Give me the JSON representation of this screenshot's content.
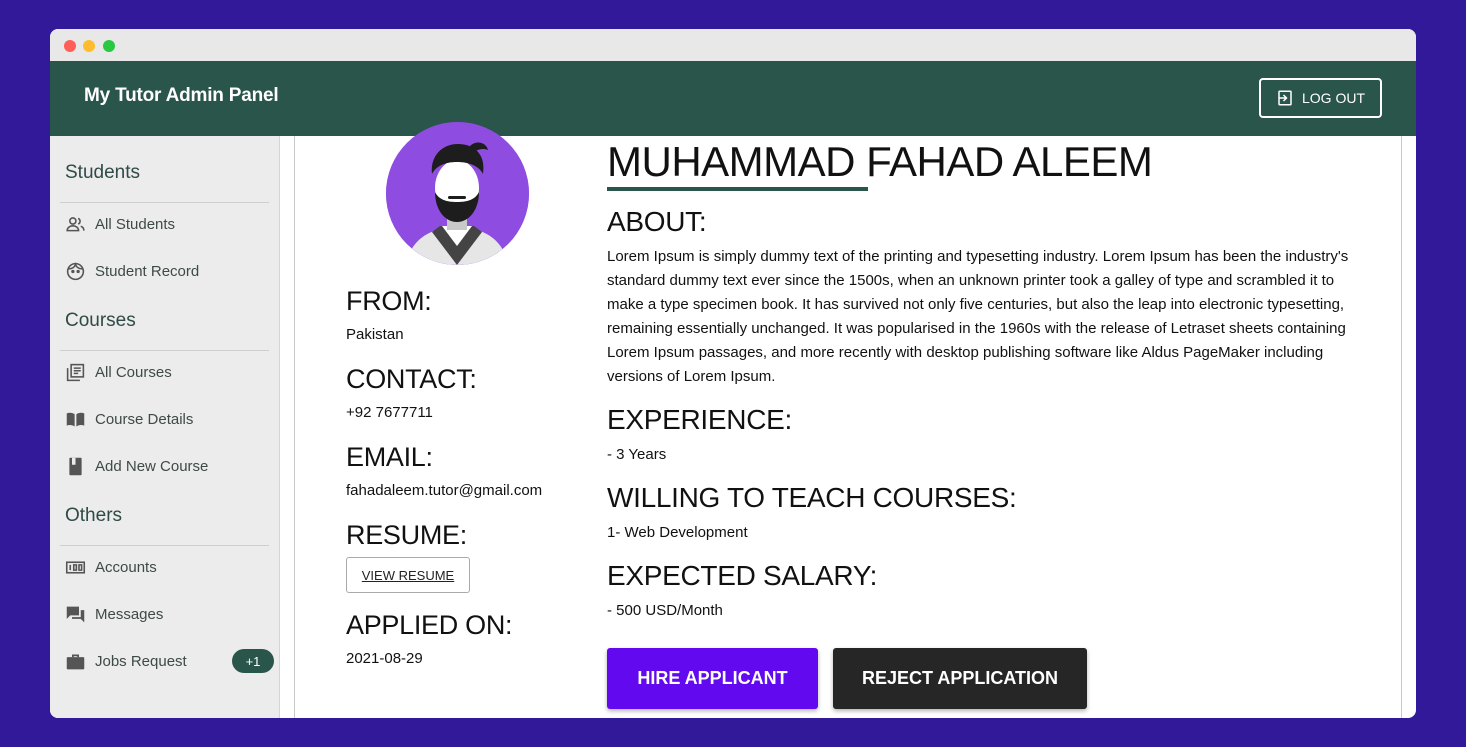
{
  "appbar": {
    "title": "My Tutor Admin Panel",
    "logout_label": "LOG OUT"
  },
  "sidebar": {
    "sections": [
      {
        "title": "Students",
        "items": [
          {
            "label": "All Students",
            "icon": "people-icon"
          },
          {
            "label": "Student Record",
            "icon": "face-icon"
          }
        ]
      },
      {
        "title": "Courses",
        "items": [
          {
            "label": "All Courses",
            "icon": "library-books-icon"
          },
          {
            "label": "Course Details",
            "icon": "open-book-icon"
          },
          {
            "label": "Add New Course",
            "icon": "book-icon"
          }
        ]
      },
      {
        "title": "Others",
        "items": [
          {
            "label": "Accounts",
            "icon": "counter-icon"
          },
          {
            "label": "Messages",
            "icon": "forum-icon"
          },
          {
            "label": "Jobs Request",
            "icon": "briefcase-icon",
            "badge": "+1"
          }
        ]
      }
    ]
  },
  "profile": {
    "name": "MUHAMMAD FAHAD ALEEM",
    "from_label": "FROM:",
    "from": "Pakistan",
    "contact_label": "CONTACT:",
    "contact": "+92 7677711",
    "email_label": "EMAIL:",
    "email": "fahadaleem.tutor@gmail.com",
    "resume_label": "RESUME:",
    "resume_button": "VIEW RESUME",
    "applied_label": "APPLIED ON:",
    "applied_on": "2021-08-29",
    "about_label": "ABOUT:",
    "about": "Lorem Ipsum is simply dummy text of the printing and typesetting industry. Lorem Ipsum has been the industry's standard dummy text ever since the 1500s, when an unknown printer took a galley of type and scrambled it to make a type specimen book. It has survived not only five centuries, but also the leap into electronic typesetting, remaining essentially unchanged. It was popularised in the 1960s with the release of Letraset sheets containing Lorem Ipsum passages, and more recently with desktop publishing software like Aldus PageMaker including versions of Lorem Ipsum.",
    "experience_label": "EXPERIENCE:",
    "experience": "- 3 Years",
    "courses_label": "WILLING TO TEACH COURSES:",
    "courses": "1- Web Development",
    "salary_label": "EXPECTED SALARY:",
    "salary": "- 500 USD/Month",
    "hire_button": "HIRE APPLICANT",
    "reject_button": "REJECT APPLICATION"
  },
  "colors": {
    "background": "#31199a",
    "appbar": "#2a554b",
    "hire": "#6309f0",
    "reject": "#262626"
  }
}
